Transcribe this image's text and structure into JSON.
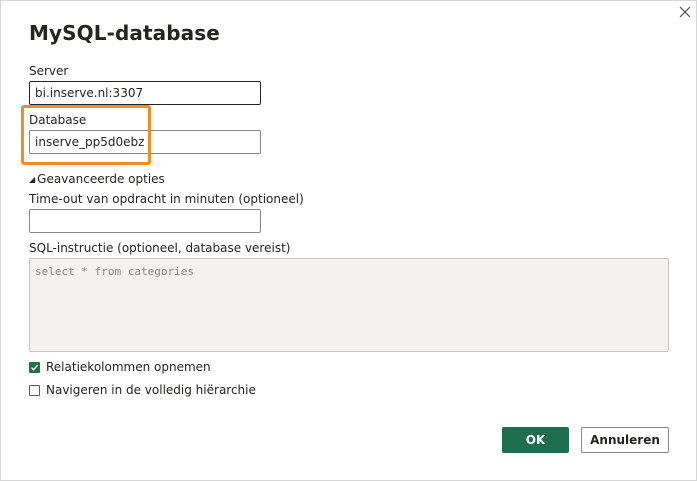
{
  "dialog": {
    "title": "MySQL-database",
    "close_icon": "close-icon"
  },
  "server": {
    "label": "Server",
    "value": "bi.inserve.nl:3307"
  },
  "database": {
    "label": "Database",
    "value": "inserve_pp5d0ebz",
    "highlight_color": "#f28c28"
  },
  "advanced": {
    "toggle_label": "Geavanceerde opties",
    "toggle_icon": "triangle-down-icon",
    "timeout": {
      "label": "Time-out van opdracht in minuten (optioneel)",
      "value": ""
    },
    "sql": {
      "label": "SQL-instructie (optioneel, database vereist)",
      "placeholder": "select * from categories"
    },
    "include_relations": {
      "label": "Relatiekolommen opnemen",
      "checked": true
    },
    "full_hierarchy": {
      "label": "Navigeren in de volledig hiërarchie",
      "checked": false
    }
  },
  "footer": {
    "ok_label": "OK",
    "cancel_label": "Annuleren",
    "primary_color": "#1d6e4e"
  }
}
